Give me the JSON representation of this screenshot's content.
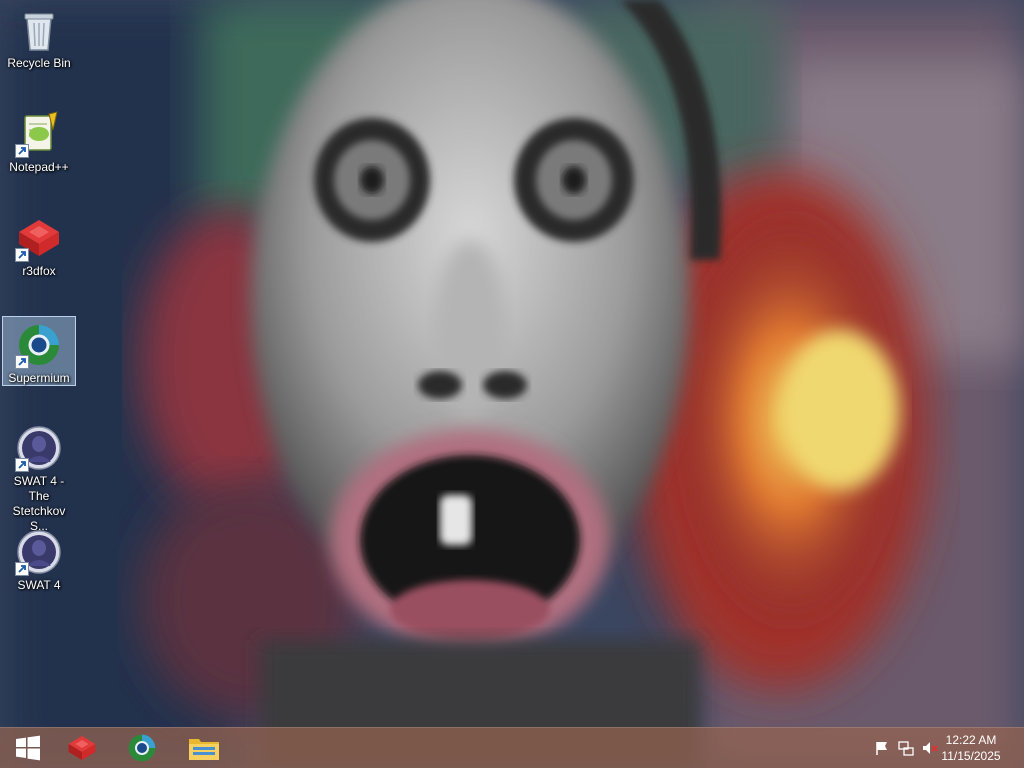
{
  "desktop": {
    "icons": [
      {
        "label": "Recycle Bin",
        "icon": "recycle-bin-icon",
        "shortcut": false,
        "selected": false
      },
      {
        "label": "Notepad++",
        "icon": "notepad-plus-plus-icon",
        "shortcut": true,
        "selected": false
      },
      {
        "label": "r3dfox",
        "icon": "r3dfox-icon",
        "shortcut": true,
        "selected": false
      },
      {
        "label": "Supermium",
        "icon": "supermium-icon",
        "shortcut": true,
        "selected": true
      },
      {
        "label": "SWAT 4 - The Stetchkov S...",
        "icon": "swat4-icon",
        "shortcut": true,
        "selected": false
      },
      {
        "label": "SWAT 4",
        "icon": "swat4-icon",
        "shortcut": true,
        "selected": false
      }
    ]
  },
  "taskbar": {
    "pinned": [
      {
        "name": "start-button",
        "icon": "windows-logo-icon"
      },
      {
        "name": "r3dfox",
        "icon": "r3dfox-icon"
      },
      {
        "name": "supermium",
        "icon": "supermium-icon"
      },
      {
        "name": "file-explorer",
        "icon": "folder-icon"
      }
    ],
    "tray": [
      {
        "name": "action-center",
        "icon": "flag-icon"
      },
      {
        "name": "network",
        "icon": "network-icon"
      },
      {
        "name": "volume",
        "icon": "speaker-muted-icon"
      }
    ],
    "clock": {
      "time": "12:22 AM",
      "date": "11/15/2025"
    }
  },
  "colors": {
    "taskbar": "#96644f",
    "selection": "#b4d2f0"
  }
}
